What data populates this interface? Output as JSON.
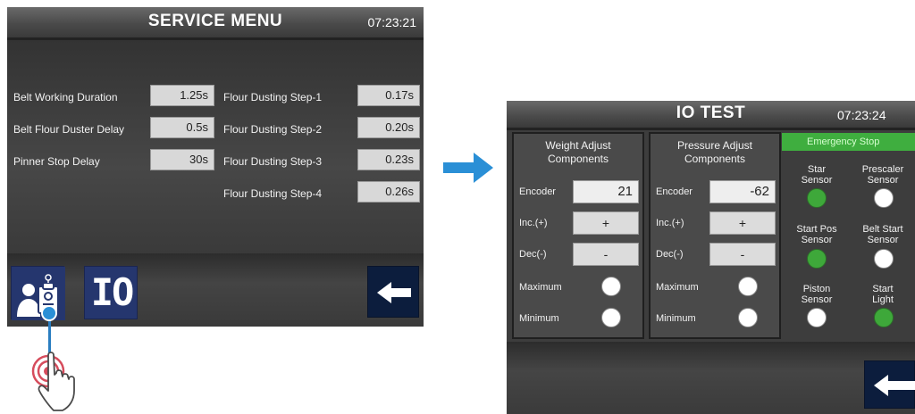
{
  "service_menu": {
    "title": "SERVICE MENU",
    "clock": "07:23:21",
    "rows_left": [
      {
        "label": "Belt Working Duration",
        "value": "1.25s"
      },
      {
        "label": "Belt Flour Duster Delay",
        "value": "0.5s"
      },
      {
        "label": "Pinner Stop Delay",
        "value": "30s"
      }
    ],
    "rows_right": [
      {
        "label": "Flour Dusting Step-1",
        "value": "0.17s"
      },
      {
        "label": "Flour Dusting Step-2",
        "value": "0.20s"
      },
      {
        "label": "Flour Dusting Step-3",
        "value": "0.23s"
      },
      {
        "label": "Flour Dusting Step-4",
        "value": "0.26s"
      }
    ],
    "io_button_label": "IO",
    "icons": {
      "service": "service-technician-icon",
      "back": "back-arrow-icon"
    }
  },
  "io_test": {
    "title": "IO TEST",
    "clock": "07:23:24",
    "weight": {
      "heading_line1": "Weight Adjust",
      "heading_line2": "Components",
      "encoder_label": "Encoder",
      "encoder_value": "21",
      "inc_label": "Inc.(+)",
      "inc_button": "+",
      "dec_label": "Dec(-)",
      "dec_button": "-",
      "max_label": "Maximum",
      "min_label": "Minimum",
      "max_on": false,
      "min_on": false
    },
    "pressure": {
      "heading_line1": "Pressure Adjust",
      "heading_line2": "Components",
      "encoder_label": "Encoder",
      "encoder_value": "-62",
      "inc_label": "Inc.(+)",
      "inc_button": "+",
      "dec_label": "Dec(-)",
      "dec_button": "-",
      "max_label": "Maximum",
      "min_label": "Minimum",
      "max_on": false,
      "min_on": false
    },
    "emergency_stop_label": "Emergency Stop",
    "sensors": [
      {
        "line1": "Star",
        "line2": "Sensor",
        "on": true
      },
      {
        "line1": "Prescaler",
        "line2": "Sensor",
        "on": false
      },
      {
        "line1": "Start Pos",
        "line2": "Sensor",
        "on": true
      },
      {
        "line1": "Belt Start",
        "line2": "Sensor",
        "on": false
      },
      {
        "line1": "Piston",
        "line2": "Sensor",
        "on": false
      },
      {
        "line1": "Start",
        "line2": "Light",
        "on": true
      }
    ],
    "colors": {
      "led_on": "#3ea83a",
      "led_off": "#ffffff",
      "emergency": "#3fae3f"
    }
  },
  "annotations": {
    "transition_arrow": "right-arrow-icon",
    "tap_indicator": "tap-hand-icon",
    "arrow_color": "#2a8fd6"
  }
}
